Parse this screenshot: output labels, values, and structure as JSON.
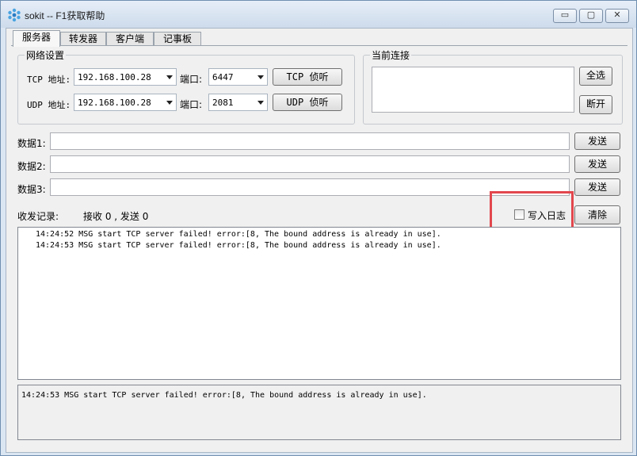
{
  "window": {
    "title": "sokit -- F1获取帮助",
    "minimize_glyph": "▭",
    "maximize_glyph": "▢",
    "close_glyph": "✕"
  },
  "tabs": [
    {
      "label": "服务器",
      "active": true
    },
    {
      "label": "转发器",
      "active": false
    },
    {
      "label": "客户端",
      "active": false
    },
    {
      "label": "记事板",
      "active": false
    }
  ],
  "network": {
    "group_title": "网络设置",
    "tcp_label": "TCP 地址:",
    "udp_label": "UDP 地址:",
    "tcp_address": "192.168.100.28",
    "udp_address": "192.168.100.28",
    "port_label": "端口:",
    "tcp_port": "6447",
    "udp_port": "2081",
    "tcp_listen": "TCP 侦听",
    "udp_listen": "UDP 侦听"
  },
  "connections": {
    "group_title": "当前连接",
    "select_all": "全选",
    "disconnect": "断开"
  },
  "data_rows": [
    {
      "label": "数据1:",
      "value": "",
      "send": "发送"
    },
    {
      "label": "数据2:",
      "value": "",
      "send": "发送"
    },
    {
      "label": "数据3:",
      "value": "",
      "send": "发送"
    }
  ],
  "records": {
    "label": "收发记录:",
    "stats": "接收 0 , 发送 0",
    "write_log": "写入日志",
    "write_log_checked": false,
    "clear": "清除"
  },
  "log_lines": [
    "14:24:52 MSG start TCP server failed! error:[8, The bound address is already in use].",
    "14:24:53 MSG start TCP server failed! error:[8, The bound address is already in use]."
  ],
  "status_text": "14:24:53 MSG start TCP server failed! error:[8, The bound address is already in use].",
  "colors": {
    "highlight": "#e2474d",
    "titlebar": "#cddbeb"
  }
}
